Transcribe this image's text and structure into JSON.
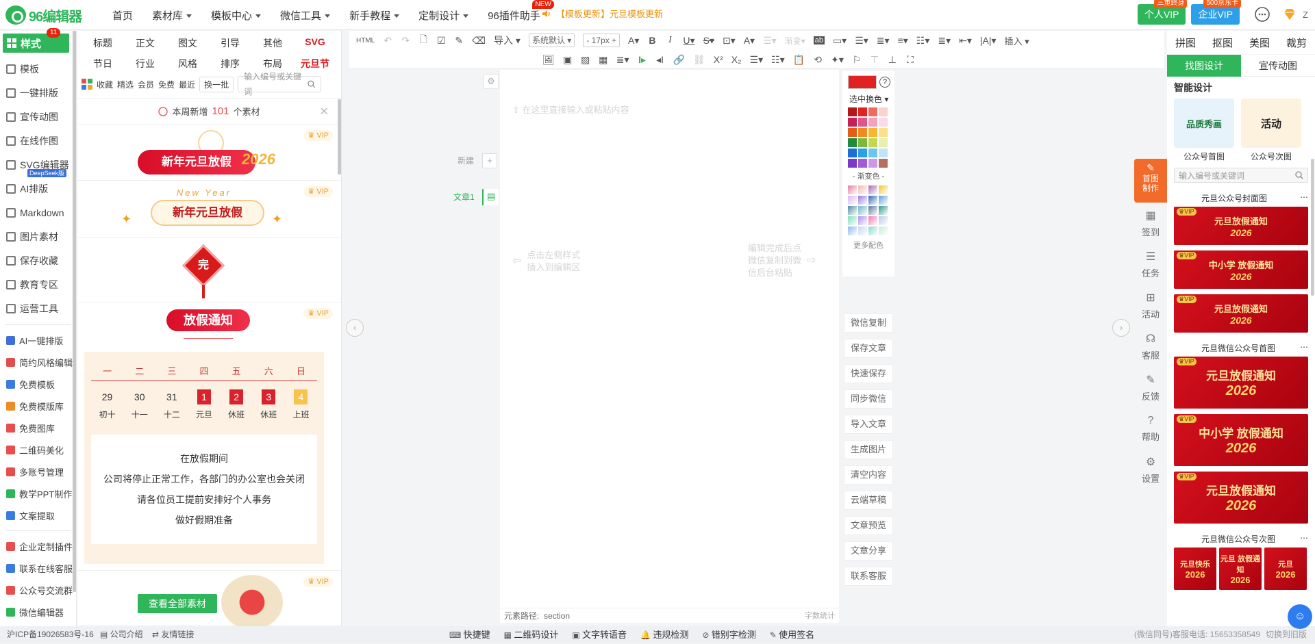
{
  "app": {
    "logo_text": "96编辑器",
    "brand_color": "#2fb55a",
    "accent_red": "#d81a1a"
  },
  "topnav": {
    "items": [
      {
        "label": "首页",
        "caret": false
      },
      {
        "label": "素材库",
        "caret": true
      },
      {
        "label": "模板中心",
        "caret": true
      },
      {
        "label": "微信工具",
        "caret": true
      },
      {
        "label": "新手教程",
        "caret": true
      },
      {
        "label": "定制设计",
        "caret": true
      },
      {
        "label": "96插件助手",
        "caret": false,
        "badge": "NEW"
      }
    ],
    "announcement": "【模板更新】元旦模板更新",
    "personal_vip": {
      "label": "个人VIP",
      "tag": "三重终身"
    },
    "enterprise_vip": {
      "label": "企业VIP",
      "tag": "500京东卡"
    },
    "user_label": "Z"
  },
  "left_sidebar": {
    "active": {
      "label": "样式",
      "badge": "11"
    },
    "items": [
      {
        "label": "模板",
        "icon": "layers-icon"
      },
      {
        "label": "一键排版",
        "icon": "copy-icon"
      },
      {
        "label": "宣传动图",
        "icon": "gif-icon"
      },
      {
        "label": "在线作图",
        "icon": "edit-icon"
      },
      {
        "label": "SVG编辑器",
        "icon": "svg-icon",
        "badge": "DeepSeek版"
      },
      {
        "label": "AI排版",
        "icon": "ai-icon"
      },
      {
        "label": "Markdown",
        "icon": "grid-icon"
      },
      {
        "label": "图片素材",
        "icon": "image-icon"
      },
      {
        "label": "保存收藏",
        "icon": "heart-icon"
      },
      {
        "label": "教育专区",
        "icon": "book-icon"
      },
      {
        "label": "运营工具",
        "icon": "grid-icon"
      }
    ],
    "tools": [
      {
        "label": "AI一键排版",
        "color": "#3f6fd8"
      },
      {
        "label": "简约风格编辑",
        "color": "#e34d4d"
      },
      {
        "label": "免费模板",
        "color": "#3a7be0"
      },
      {
        "label": "免费模版库",
        "color": "#f08a24"
      },
      {
        "label": "免费图库",
        "color": "#e94e4e"
      },
      {
        "label": "二维码美化",
        "color": "#e94e4e"
      },
      {
        "label": "多账号管理",
        "color": "#e94e4e"
      },
      {
        "label": "教学PPT制作",
        "color": "#2fb55a"
      },
      {
        "label": "文案提取",
        "color": "#3a7be0"
      }
    ],
    "extras": [
      {
        "label": "企业定制插件",
        "color": "#e94e4e"
      },
      {
        "label": "联系在线客服",
        "color": "#3a7be0"
      },
      {
        "label": "公众号交流群",
        "color": "#e94e4e"
      },
      {
        "label": "微信编辑器",
        "color": "#2fb55a"
      }
    ]
  },
  "material_panel": {
    "categories_row1": [
      "标题",
      "正文",
      "图文",
      "引导",
      "其他",
      "SVG"
    ],
    "categories_row2": [
      "节日",
      "行业",
      "风格",
      "排序",
      "布局",
      "元旦节"
    ],
    "filters": [
      "收藏",
      "精选",
      "会员",
      "免费",
      "最近"
    ],
    "refresh_label": "换一批",
    "search_placeholder": "输入编号或关键词",
    "weekly_prefix": "本周新增",
    "weekly_count": "101",
    "weekly_suffix": "个素材",
    "vip_label": "VIP",
    "card1": {
      "title": "新年元旦放假",
      "year": "2026"
    },
    "card2": {
      "subtitle": "New Year",
      "title": "新年元旦放假"
    },
    "card3": {
      "char": "完"
    },
    "card4": {
      "title": "放假通知",
      "weekdays": [
        "一",
        "二",
        "三",
        "四",
        "五",
        "六",
        "日"
      ],
      "dates": [
        "29",
        "30",
        "31",
        "1",
        "2",
        "3",
        "4"
      ],
      "lunar": [
        "初十",
        "十一",
        "十二",
        "元旦",
        "休班",
        "休班",
        "上班"
      ],
      "lines": [
        "在放假期间",
        "公司将停止正常工作，各部门的办公室也会关闭",
        "请各位员工提前安排好个人事务",
        "做好假期准备"
      ]
    },
    "view_all_label": "查看全部素材"
  },
  "toolbar": {
    "import_label": "导入",
    "font_family": "系统默认",
    "font_size": "17px",
    "insert_label": "插入",
    "gradient_label": "渐变"
  },
  "editor": {
    "placeholder": "在这里直接输入或粘贴内容",
    "new_label": "新建",
    "doc_label": "文章1",
    "hint_left_line1": "点击左侧样式",
    "hint_left_line2": "插入到编辑区",
    "hint_right_line1": "编辑完成后点",
    "hint_right_line2": "微信复制到微",
    "hint_right_line3": "信后台粘贴",
    "path_label": "元素路径:",
    "path_value": "section",
    "word_count_label": "字数统计"
  },
  "palette": {
    "current_color": "#e02222",
    "swap_label": "选中换色",
    "gradient_label": "- 渐变色 -",
    "more_label": "更多配色",
    "colors": [
      "#b4161b",
      "#e02222",
      "#ef6b5d",
      "#fbd3cc",
      "#c81f57",
      "#e0558a",
      "#f2a1bf",
      "#fbd9e6",
      "#e65c17",
      "#f28a22",
      "#f7b733",
      "#fde08a",
      "#1f8b3b",
      "#7cb83a",
      "#c5d84b",
      "#e8f0b0",
      "#1d6fd1",
      "#2d9ee8",
      "#6cc7f0",
      "#bfe5f7",
      "#7b3ac9",
      "#a35bd5",
      "#c99be6",
      "#b86e5d"
    ],
    "gradients": [
      "#e57fa0",
      "#f0b9b0",
      "#a66ab0",
      "#f4c430",
      "#d8b6f0",
      "#9a7be0",
      "#2f68b5",
      "#5aa0d8",
      "#4b8fa0",
      "#6cb6c6",
      "#5b7a9a",
      "#2f9a8c",
      "#7ee0b8",
      "#b38cf0",
      "#ef7ab0",
      "#b9c9e6",
      "#8fb8ef",
      "#c3d8f5",
      "#8bd8d0",
      "#c8ecd6"
    ]
  },
  "side_actions": [
    "微信复制",
    "保存文章",
    "快速保存",
    "同步微信",
    "导入文章",
    "生成图片",
    "清空内容",
    "云端草稿",
    "文章预览",
    "文章分享",
    "联系客服"
  ],
  "right_panel": {
    "tabs": [
      "拼图",
      "抠图",
      "美图",
      "裁剪"
    ],
    "subtabs": [
      "找图设计",
      "宣传动图"
    ],
    "smart_title": "智能设计",
    "smart_items": [
      {
        "label": "公众号首图",
        "thumb_text": "品质秀画"
      },
      {
        "label": "公众号次图",
        "thumb_text": "活动"
      }
    ],
    "search_placeholder": "输入编号或关键词",
    "section1": "元旦公众号封面图",
    "section1_thumbs": [
      {
        "text": "元旦放假通知",
        "year": "2026"
      },
      {
        "text": "中小学 放假通知",
        "year": "2026"
      },
      {
        "text": "元旦放假通知",
        "year": "2026"
      }
    ],
    "section2": "元旦微信公众号首图",
    "section2_thumbs": [
      {
        "text": "元旦放假通知",
        "year": "2026"
      },
      {
        "text": "中小学 放假通知",
        "year": "2026"
      },
      {
        "text": "元旦放假通知",
        "year": "2026"
      }
    ],
    "section3": "元旦微信公众号次图",
    "section3_thumbs": [
      {
        "text": "元旦快乐",
        "year": "2026"
      },
      {
        "text": "元旦 放假通知",
        "year": "2026"
      },
      {
        "text": "元旦",
        "year": "2026"
      }
    ]
  },
  "right_sidebar": {
    "active_label": "首图制作",
    "items": [
      "签到",
      "任务",
      "活动",
      "客服",
      "反馈",
      "帮助",
      "设置"
    ]
  },
  "footer": {
    "icp": "沪ICP备19026583号-16",
    "about": "公司介绍",
    "links": "友情链接",
    "center_items": [
      "快捷键",
      "二维码设计",
      "文字转语音",
      "违规检测",
      "错别字检测",
      "使用签名"
    ],
    "right": "(微信同号)客服电话: 15653358549",
    "switch_label": "切换到旧版"
  }
}
